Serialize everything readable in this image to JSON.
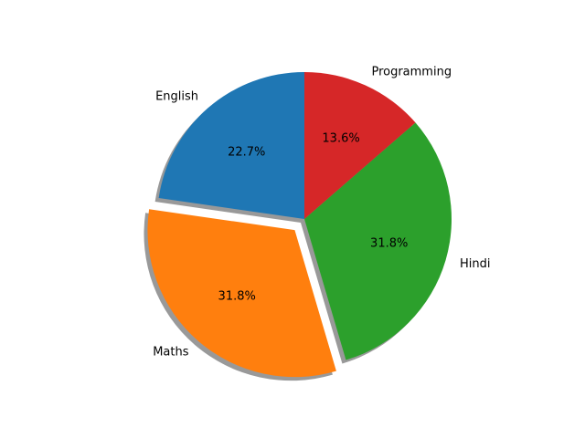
{
  "chart_data": {
    "type": "pie",
    "title": "",
    "start_angle_deg": 90,
    "counterclockwise": true,
    "shadow": true,
    "slices": [
      {
        "label": "English",
        "value": 22.7,
        "pct_label": "22.7%",
        "color": "#1f77b4",
        "explode": 0.0
      },
      {
        "label": "Maths",
        "value": 31.8,
        "pct_label": "31.8%",
        "color": "#ff7f0e",
        "explode": 0.1
      },
      {
        "label": "Hindi",
        "value": 31.8,
        "pct_label": "31.8%",
        "color": "#2ca02c",
        "explode": 0.0
      },
      {
        "label": "Programming",
        "value": 13.6,
        "pct_label": "13.6%",
        "color": "#d62728",
        "explode": 0.0
      }
    ]
  }
}
